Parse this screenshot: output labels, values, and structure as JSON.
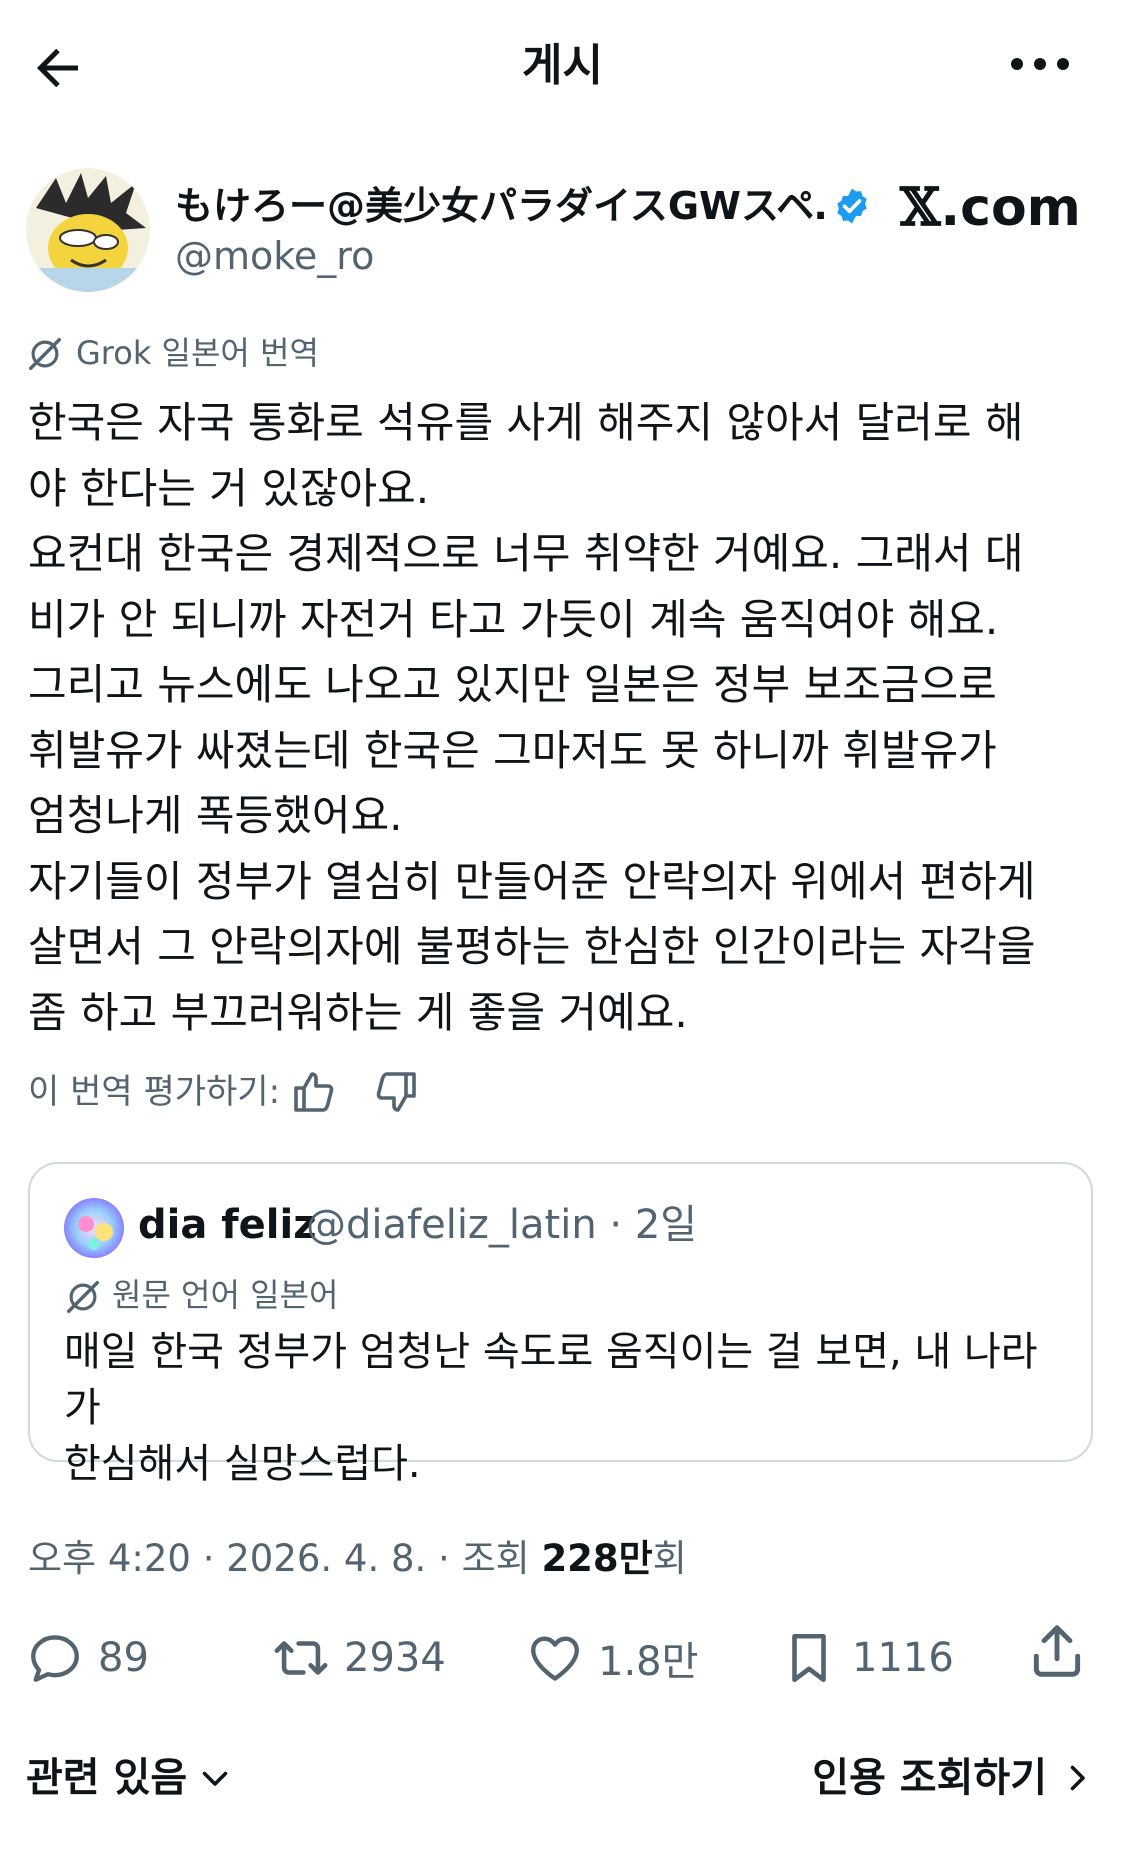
{
  "header": {
    "title": "게시",
    "back_icon": "arrow-left-icon",
    "more_icon": "more-horizontal-icon"
  },
  "author": {
    "name": "もけろー@美少女パラダイスGWスペ…",
    "handle": "@moke_ro",
    "verified": true,
    "verified_color": "#1d9bf0"
  },
  "watermark": {
    "prefix": "𝕏",
    "suffix": ".com"
  },
  "translation": {
    "label": "Grok 일본어 번역",
    "icon": "grok-icon"
  },
  "post": {
    "paragraphs": [
      "한국은 자국 통화로 석유를 사게 해주지 않아서 달러로 해\n야 한다는 거 있잖아요.",
      "요컨대 한국은 경제적으로 너무 취약한 거예요. 그래서 대\n비가 안 되니까 자전거 타고 가듯이 계속 움직여야 해요.",
      "그리고 뉴스에도 나오고 있지만 일본은 정부 보조금으로\n휘발유가 싸졌는데 한국은 그마저도 못 하니까 휘발유가\n엄청나게 폭등했어요.",
      "자기들이 정부가 열심히 만들어준 안락의자 위에서 편하게\n살면서 그 안락의자에 불평하는 한심한 인간이라는 자각을\n좀 하고 부끄러워하는 게 좋을 거예요."
    ]
  },
  "rating": {
    "label": "이 번역 평가하기:",
    "up_icon": "thumbs-up-icon",
    "down_icon": "thumbs-down-icon"
  },
  "quote": {
    "name": "dia feliz",
    "meta": "@diafeliz_latin · 2일",
    "translation_label": "원문 언어 일본어",
    "text": "매일 한국 정부가 엄청난 속도로 움직이는 걸 보면, 내 나라가\n한심해서 실망스럽다."
  },
  "meta": {
    "time": "오후 4:20",
    "sep1": " · ",
    "date": "2026. 4. 8.",
    "sep2": " · ",
    "views_prefix": "조회 ",
    "views_count": "228만",
    "views_suffix": "회"
  },
  "actions": {
    "reply_count": "89",
    "retweet_count": "2934",
    "like_count": "1.8만",
    "bookmark_count": "1116"
  },
  "bottom": {
    "related": "관련 있음",
    "quotes": "인용 조회하기"
  },
  "colors": {
    "text": "#0f1419",
    "secondary": "#536471",
    "border": "#cfd9de",
    "accent": "#1d9bf0"
  }
}
